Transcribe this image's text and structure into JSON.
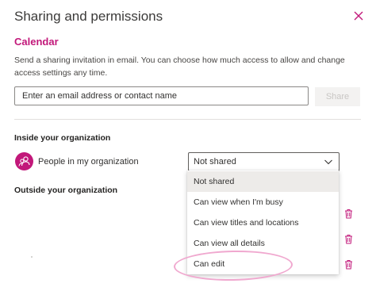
{
  "dialog": {
    "title": "Sharing and permissions",
    "calendar_name": "Calendar",
    "description": "Send a sharing invitation in email. You can choose how much access to allow and change access settings any time.",
    "email_placeholder": "Enter an email address or contact name",
    "share_label": "Share"
  },
  "inside": {
    "heading": "Inside your organization",
    "person_label": "People in my organization",
    "permission_value": "Not shared"
  },
  "outside": {
    "heading": "Outside your organization"
  },
  "dropdown": {
    "options": [
      "Not shared",
      "Can view when I'm busy",
      "Can view titles and locations",
      "Can view all details",
      "Can edit"
    ],
    "selected": "Not shared"
  },
  "colors": {
    "accent": "#c2187a",
    "highlight_ring": "#f0a8cf"
  },
  "icons": [
    "close-icon",
    "people-icon",
    "chevron-down-icon",
    "trash-icon"
  ]
}
